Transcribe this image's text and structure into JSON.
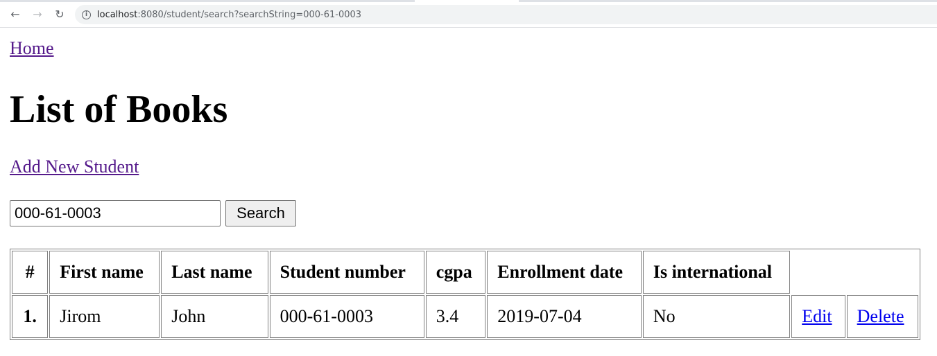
{
  "browser": {
    "url_host": "localhost",
    "url_rest": ":8080/student/search?searchString=000-61-0003"
  },
  "page": {
    "home_link": "Home",
    "title": "List of Books",
    "add_link": "Add New Student",
    "search": {
      "value": "000-61-0003",
      "button_label": "Search"
    }
  },
  "table": {
    "headers": [
      "#",
      "First name",
      "Last name",
      "Student number",
      "cgpa",
      "Enrollment date",
      "Is international"
    ],
    "rows": [
      {
        "index": "1.",
        "first_name": "Jirom",
        "last_name": "John",
        "student_number": "000-61-0003",
        "cgpa": "3.4",
        "enrollment_date": "2019-07-04",
        "is_international": "No",
        "edit_label": "Edit",
        "delete_label": "Delete"
      }
    ]
  }
}
